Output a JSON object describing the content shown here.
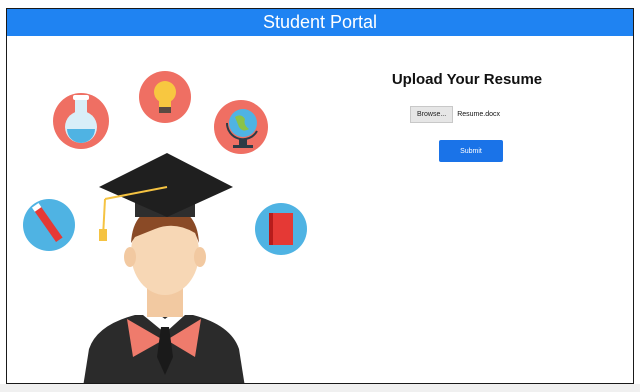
{
  "header": {
    "title": "Student Portal"
  },
  "upload": {
    "title": "Upload Your Resume",
    "browse_label": "Browse...",
    "file_name": "Resume.docx",
    "submit_label": "Submit"
  },
  "colors": {
    "header": "#1f83f2",
    "submit": "#1a73e8",
    "circle_red": "#ef6f63",
    "circle_blue": "#4fb3e3"
  },
  "illustration": {
    "icons": [
      "flask-icon",
      "lightbulb-icon",
      "globe-icon",
      "pencil-icon",
      "book-icon",
      "graduation-cap-icon"
    ]
  }
}
